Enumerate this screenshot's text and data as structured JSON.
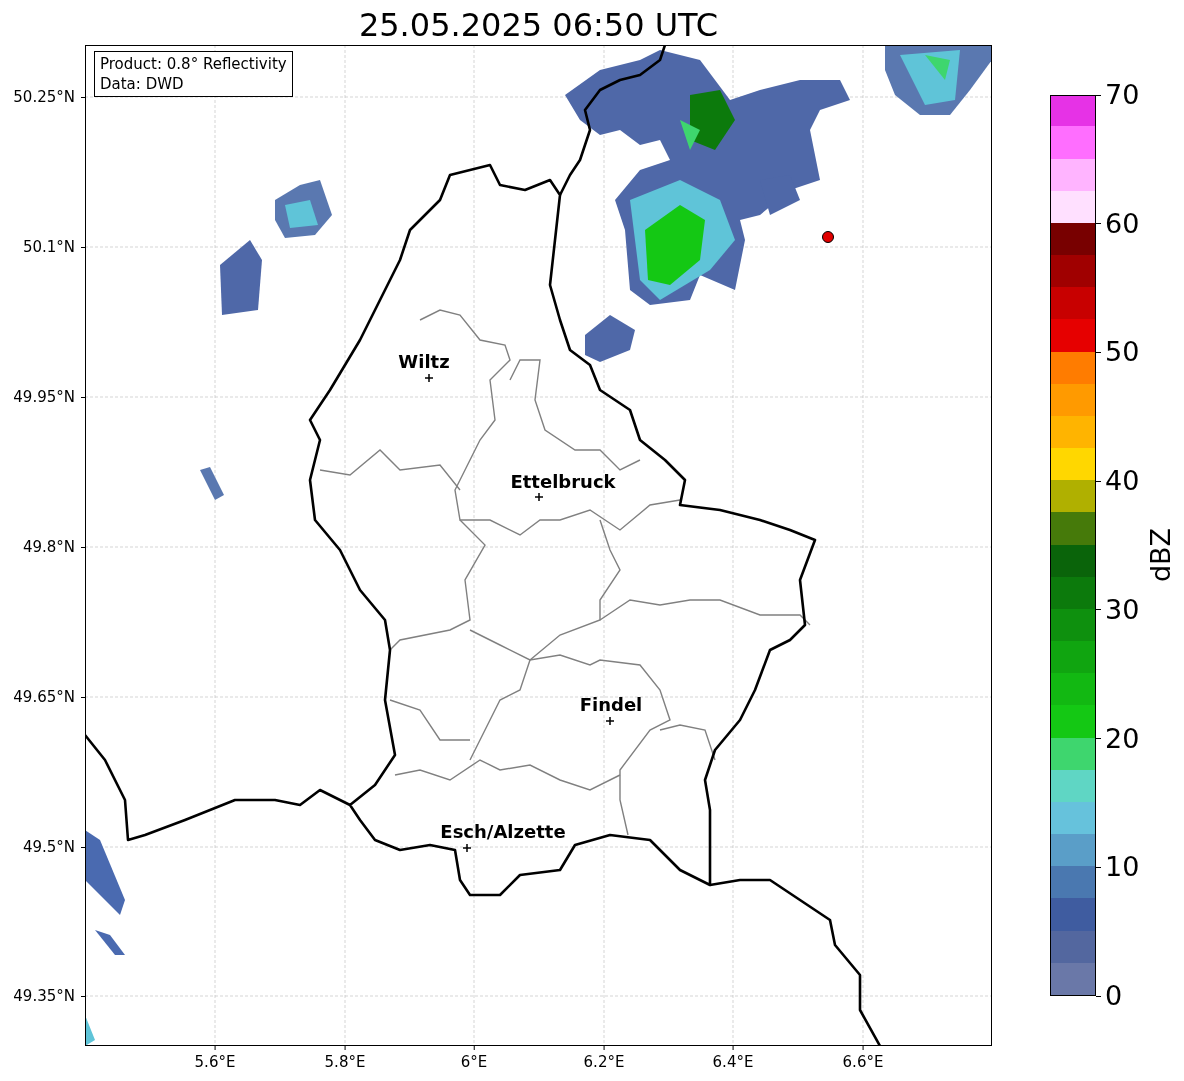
{
  "title": "25.05.2025 06:50 UTC",
  "info_box": [
    "Product: 0.8° Reflectivity",
    "Data: DWD"
  ],
  "map": {
    "latitude_ticks": [
      "50.25°N",
      "50.1°N",
      "49.95°N",
      "49.8°N",
      "49.65°N",
      "49.5°N",
      "49.35°N"
    ],
    "longitude_ticks": [
      "5.6°E",
      "5.8°E",
      "6°E",
      "6.2°E",
      "6.4°E",
      "6.6°E"
    ],
    "places": [
      {
        "name": "Wiltz"
      },
      {
        "name": "Ettelbruck"
      },
      {
        "name": "Findel"
      },
      {
        "name": "Esch/Alzette"
      }
    ]
  },
  "colorbar": {
    "label": "dBZ",
    "ticks": [
      "70",
      "60",
      "50",
      "40",
      "30",
      "20",
      "10",
      "0"
    ],
    "bins": [
      {
        "color": "#6a78a8"
      },
      {
        "color": "#53679f"
      },
      {
        "color": "#3f5ca0"
      },
      {
        "color": "#4a78b0"
      },
      {
        "color": "#5a9ec8"
      },
      {
        "color": "#66c2dc"
      },
      {
        "color": "#5fd6c4"
      },
      {
        "color": "#3ed66e"
      },
      {
        "color": "#14c814"
      },
      {
        "color": "#12b812"
      },
      {
        "color": "#10a510"
      },
      {
        "color": "#0e900e"
      },
      {
        "color": "#0c7a0c"
      },
      {
        "color": "#0a640a"
      },
      {
        "color": "#467a0a"
      },
      {
        "color": "#b0b000"
      },
      {
        "color": "#ffd700"
      },
      {
        "color": "#ffb400"
      },
      {
        "color": "#ff9a00"
      },
      {
        "color": "#ff7c00"
      },
      {
        "color": "#e60000"
      },
      {
        "color": "#c80000"
      },
      {
        "color": "#a00000"
      },
      {
        "color": "#780000"
      },
      {
        "color": "#ffe0ff"
      },
      {
        "color": "#ffb4ff"
      },
      {
        "color": "#ff6eff"
      },
      {
        "color": "#e632e6"
      }
    ]
  }
}
